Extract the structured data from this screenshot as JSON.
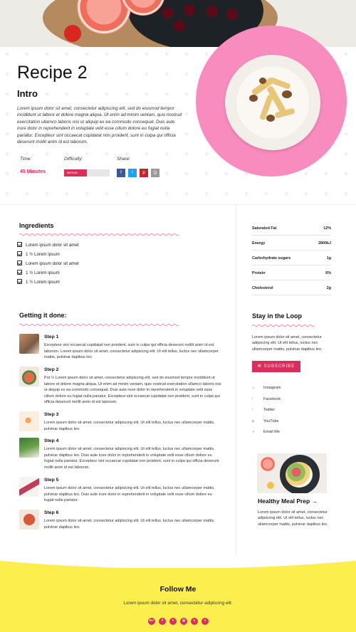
{
  "hero": {
    "title": "Recipe 2",
    "intro_title": "Intro",
    "intro_text": "Lorem ipsum dolor sit amet, consectetur adipiscing elit, sed do eiusmod tempor incididunt ut labore et dolore magna aliqua. Ut enim ad minim veniam, quis nostrud exercitation ullamco laboris nisi ut aliquip ex ea commodo consequat. Duis aute irure dolor in reprehenderit in voluptate velit esse cillum dolore eu fugiat nulla pariatur. Excepteur sint occaecat cupidatat non proident, sunt in culpa qui officia deserunt mollit anim id est laborum.",
    "time_label": "Time:",
    "time_value": "45 Minutes",
    "difficulty_label": "Difficulty:",
    "difficulty_value": "MEDIUM",
    "difficulty_level": 0.5,
    "share_label": "Share:",
    "share_icons": [
      {
        "name": "facebook-icon",
        "glyph": "f",
        "color": "#3b5998"
      },
      {
        "name": "twitter-icon",
        "glyph": "t",
        "color": "#1da1f2"
      },
      {
        "name": "pinterest-icon",
        "glyph": "p",
        "color": "#c8232c"
      },
      {
        "name": "print-icon",
        "glyph": "⎙",
        "color": "#999999"
      }
    ]
  },
  "ingredients": {
    "title": "Ingredients",
    "items": [
      "Lorem ipsum dolor sit amet",
      "1 ½ Lorem ipsum",
      "Lorem ipsum dolor sit amet",
      "1 ½ Lorem ipsum",
      "1 ½ Lorem ipsum"
    ]
  },
  "nutrition": [
    {
      "label": "Saturated Fat",
      "value": "12%"
    },
    {
      "label": "Energy",
      "value": "2800kJ"
    },
    {
      "label": "Carbohydrate sugars",
      "value": "1g"
    },
    {
      "label": "Protein",
      "value": "6%"
    },
    {
      "label": "Cholesterol",
      "value": "2g"
    }
  ],
  "steps": {
    "title": "Getting it done:",
    "items": [
      {
        "title": "Step 1",
        "text": "Excepteur sint occaecat cupidatat non proident, sunt in culpa qui officia deserunt mollit anim id est laborum. Lorem ipsum dolor sit amet, consectetur adipiscing elit. Ut elit tellus, luctus nec ullamcorper mattis, pulvinar dapibus leo."
      },
      {
        "title": "Step 2",
        "text": "Put ½ Lorem ipsum dolor sit amet, consectetur adipiscing elit, sed do eiusmod tempor incididunt ut labore et dolore magna aliqua. Ut enim ad minim veniam, quis nostrud exercitation ullamco laboris nisi ut aliquip ex ea commodo consequat. Duis aute irure dolor in reprehenderit in voluptate velit esse cillum dolore eu fugiat nulla pariatur. Excepteur sint occaecat cupidatat non proident, sunt in culpa qui officia deserunt mollit anim id est laborum."
      },
      {
        "title": "Step 3",
        "text": "Lorem ipsum dolor sit amet, consectetur adipiscing elit. Ut elit tellus, luctus nec ullamcorper mattis, pulvinar dapibus leo."
      },
      {
        "title": "Step 4",
        "text": "Lorem ipsum dolor sit amet, consectetur adipiscing elit. Ut elit tellus, luctus nec ullamcorper mattis, pulvinar dapibus leo. Duis aute irure dolor in reprehenderit in voluptate velit esse cillum dolore eu fugiat nulla pariatur. Excepteur sint occaecat cupidatat non proident, sunt in culpa qui officia deserunt mollit anim id est laborum."
      },
      {
        "title": "Step 5",
        "text": "Lorem ipsum dolor sit amet, consectetur adipiscing elit. Ut elit tellus, luctus nec ullamcorper mattis, pulvinar dapibus leo. Duis aute irure dolor in reprehenderit in voluptate velit esse cillum dolore eu fugiat nulla pariatur."
      },
      {
        "title": "Step 6",
        "text": "Lorem ipsum dolor sit amet, consectetur adipiscing elit. Ut elit tellus, luctus nec ullamcorper mattis, pulvinar dapibus leo."
      }
    ]
  },
  "sidebar": {
    "loop_title": "Stay in the Loop",
    "loop_text": "Lorem ipsum dolor sit amet, consectetur adipiscing elit. Ut elit tellus, luctus nec ullamcorper mattis, pulvinar dapibus leo.",
    "subscribe_label": "SUBSCRIBE",
    "social_links": [
      "Instagram",
      "Facebook",
      "Twitter",
      "YouTube",
      "Email Me"
    ],
    "meal_title": "Healthy Meal Prep →",
    "meal_text": "Lorem ipsum dolor sit amet, consectetur adipiscing elit. Ut elit tellus, luctus nec ullamcorper mattis, pulvinar dapibus leo."
  },
  "footer": {
    "title": "Follow Me",
    "text": "Lorem ipsum dolor sit amet, consectetur adipiscing elit.",
    "icons": [
      {
        "name": "google-plus-icon",
        "glyph": "G+"
      },
      {
        "name": "facebook-icon",
        "glyph": "f"
      },
      {
        "name": "twitter-icon",
        "glyph": "t"
      },
      {
        "name": "instagram-icon",
        "glyph": "◎"
      },
      {
        "name": "vimeo-icon",
        "glyph": "v"
      },
      {
        "name": "tumblr-icon",
        "glyph": "t"
      }
    ]
  },
  "colors": {
    "accent": "#d92f5c",
    "pink_circle": "#f98cbf",
    "footer_bg": "#fcee4c"
  }
}
